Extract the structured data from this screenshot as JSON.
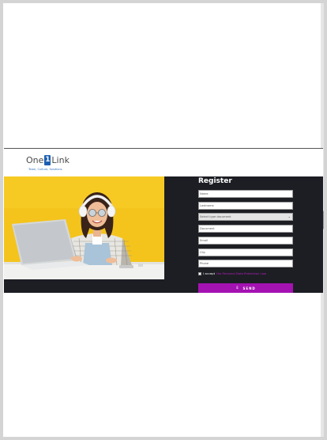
{
  "brand": {
    "logo_one": "One",
    "logo_num": "1",
    "logo_link": "Link",
    "tagline": "Team, Culture, Solutions"
  },
  "hero": {
    "image_alt": "woman with headphones using laptop"
  },
  "form": {
    "title": "Register",
    "fields": {
      "name": "Name",
      "lastname": "Lastname",
      "document_type": "Select type document",
      "document": "Document",
      "email": "Email",
      "city": "City",
      "phone": "Phone"
    },
    "terms_text": "I accept",
    "terms_link": "the Personal Data Protection Law",
    "send_label": "SEND"
  },
  "colors": {
    "dark_panel": "#1d1e24",
    "accent": "#a412b2",
    "photo_bg": "#f3c31c",
    "brand_blue": "#1d5fb2"
  }
}
